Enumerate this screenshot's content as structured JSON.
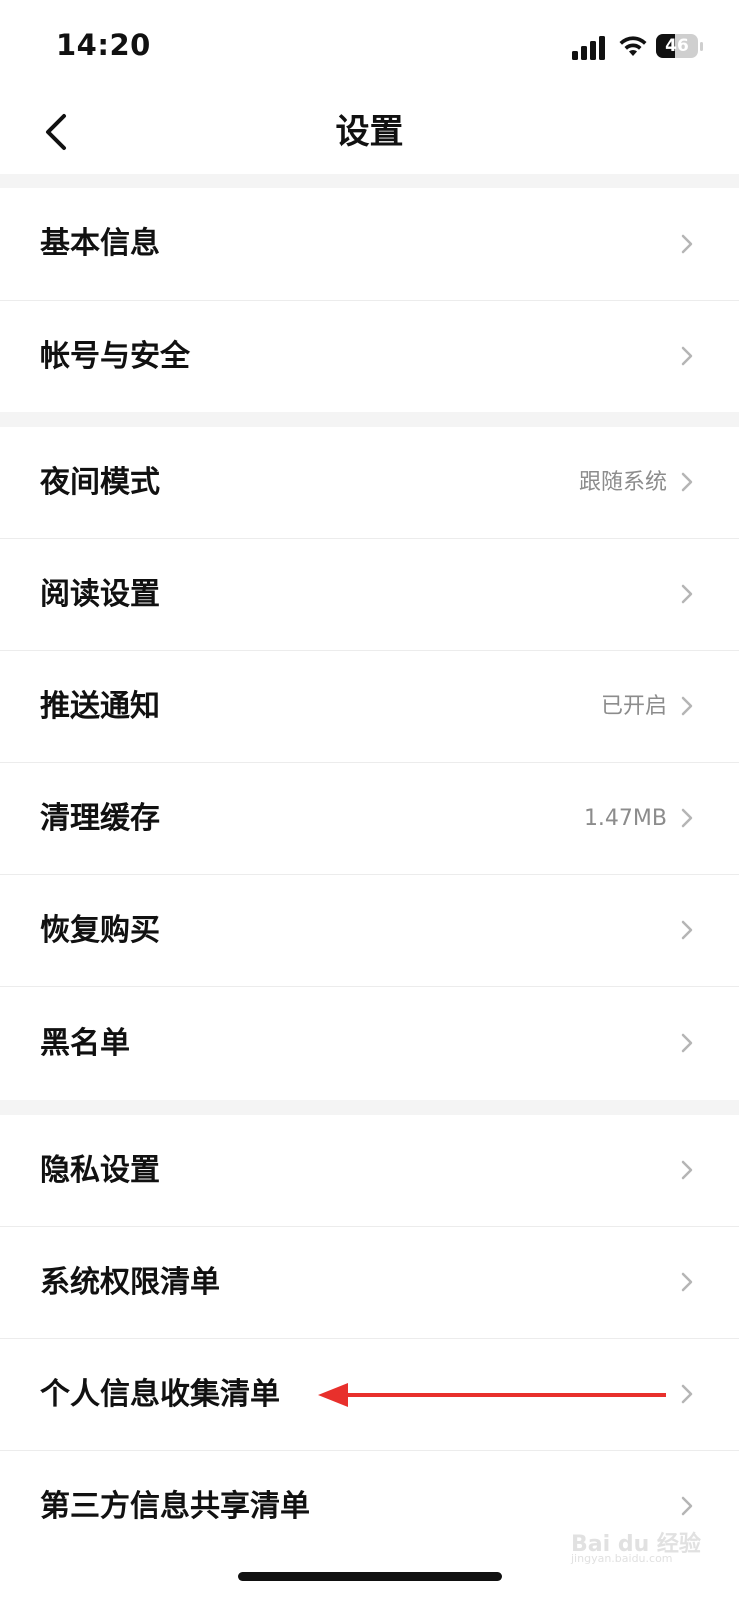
{
  "status_bar": {
    "time": "14:20",
    "battery": "46",
    "battery_level": 0.46,
    "icons": [
      "signal-icon",
      "wifi-icon",
      "battery-icon"
    ]
  },
  "nav": {
    "back_icon": "chevron-left-icon",
    "title": "设置"
  },
  "sections": [
    {
      "items": [
        {
          "label": "基本信息",
          "value": ""
        },
        {
          "label": "帐号与安全",
          "value": ""
        }
      ]
    },
    {
      "items": [
        {
          "label": "夜间模式",
          "value": "跟随系统"
        },
        {
          "label": "阅读设置",
          "value": ""
        },
        {
          "label": "推送通知",
          "value": "已开启"
        },
        {
          "label": "清理缓存",
          "value": "1.47MB"
        },
        {
          "label": "恢复购买",
          "value": ""
        },
        {
          "label": "黑名单",
          "value": ""
        }
      ]
    },
    {
      "items": [
        {
          "label": "隐私设置",
          "value": ""
        },
        {
          "label": "系统权限清单",
          "value": ""
        },
        {
          "label": "个人信息收集清单",
          "value": ""
        },
        {
          "label": "第三方信息共享清单",
          "value": ""
        }
      ]
    }
  ],
  "annotation": {
    "type": "arrow-left",
    "color": "#e8302c"
  },
  "watermark": {
    "text": "Bai du 经验",
    "sub": "jingyan.baidu.com"
  },
  "colors": {
    "section_gap": "#f4f4f4",
    "value_text": "#8c8c8c",
    "chevron": "#b5b5b5",
    "arrow": "#e8302c"
  }
}
